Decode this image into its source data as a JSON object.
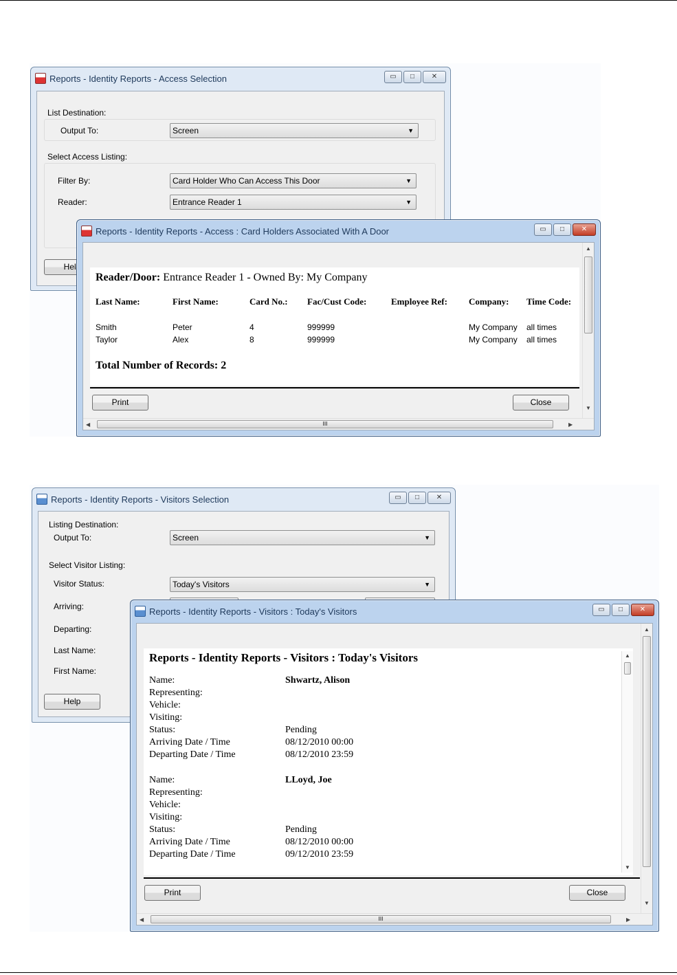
{
  "access_selection": {
    "title": "Reports - Identity Reports - Access Selection",
    "list_destination_label": "List Destination:",
    "output_to_label": "Output To:",
    "output_to_value": "Screen",
    "select_access_label": "Select Access Listing:",
    "filter_by_label": "Filter By:",
    "filter_by_value": "Card Holder Who Can Access This Door",
    "reader_label": "Reader:",
    "reader_value": "Entrance Reader 1",
    "help_label": "Help"
  },
  "access_report": {
    "title": "Reports - Identity Reports - Access : Card Holders Associated With A Door",
    "reader_door_label": "Reader/Door:",
    "reader_door_value": "Entrance Reader 1 - Owned By: My Company",
    "columns": [
      "Last Name:",
      "First Name:",
      "Card No.:",
      "Fac/Cust Code:",
      "Employee Ref:",
      "Company:",
      "Time Code:"
    ],
    "rows": [
      [
        "Smith",
        "Peter",
        "4",
        "999999",
        "",
        "My Company",
        "all times"
      ],
      [
        "Taylor",
        "Alex",
        "8",
        "999999",
        "",
        "My Company",
        "all times"
      ]
    ],
    "total": "Total Number of Records: 2",
    "print_label": "Print",
    "close_label": "Close",
    "hscroll_grip": "III"
  },
  "visitors_selection": {
    "title": "Reports - Identity Reports - Visitors Selection",
    "listing_destination_label": "Listing Destination:",
    "output_to_label": "Output To:",
    "output_to_value": "Screen",
    "select_visitor_label": "Select Visitor Listing:",
    "visitor_status_label": "Visitor Status:",
    "visitor_status_value": "Today's Visitors",
    "arriving_label": "Arriving:",
    "departing_label": "Departing:",
    "last_name_label": "Last Name:",
    "first_name_label": "First Name:",
    "help_label": "Help"
  },
  "visitors_report": {
    "title": "Reports - Identity Reports - Visitors : Today's Visitors",
    "heading": "Reports - Identity Reports - Visitors : Today's Visitors",
    "field_labels": [
      "Name:",
      "Representing:",
      "Vehicle:",
      "Visiting:",
      "Status:",
      "Arriving Date / Time",
      "Departing Date / Time"
    ],
    "visitors": [
      {
        "name": "Shwartz, Alison",
        "representing": "",
        "vehicle": "",
        "visiting": "",
        "status": "Pending",
        "arriving": "08/12/2010 00:00",
        "departing": "08/12/2010 23:59"
      },
      {
        "name": "LLoyd, Joe",
        "representing": "",
        "vehicle": "",
        "visiting": "",
        "status": "Pending",
        "arriving": "08/12/2010 00:00",
        "departing": "09/12/2010 23:59"
      }
    ],
    "print_label": "Print",
    "close_label": "Close",
    "hscroll_grip": "III"
  },
  "icons": {
    "minimize": "minimize-icon",
    "maximize": "maximize-icon",
    "close": "close-icon",
    "dropdown": "chevron-down-icon"
  },
  "window_controls": {
    "minimize_glyph": "▭",
    "maximize_glyph": "□",
    "close_glyph": "✕",
    "dropdown_glyph": "▼"
  }
}
